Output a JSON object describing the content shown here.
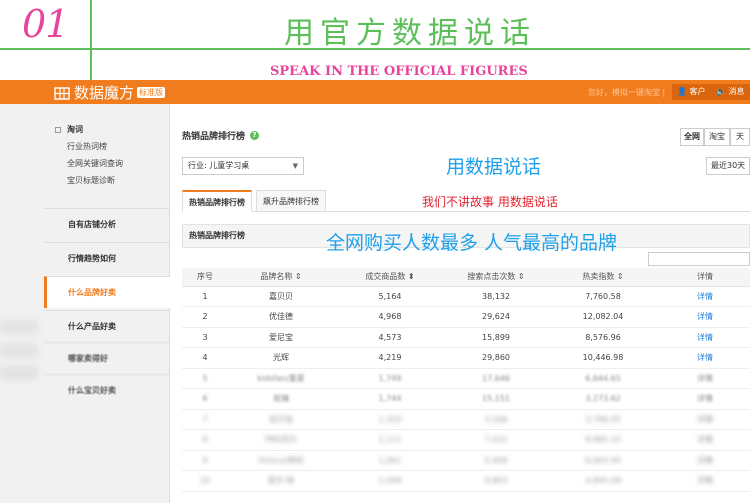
{
  "banner": {
    "number": "01",
    "headline": "用官方数据说话",
    "subtitle": "SPEAK IN THE OFFICIAL FIGURES",
    "accent_pink": "#e8449c",
    "accent_green": "#5cbf59"
  },
  "app": {
    "logo_text": "数据魔方",
    "edition": "标准版",
    "top_links": "您好，模拟一键淘宝 |",
    "client_button": "客户",
    "message_button": "消息",
    "brand_color": "#f07c1e"
  },
  "sidebar": {
    "group": {
      "title": "淘词",
      "items": [
        "行业热词榜",
        "全网关键词查询",
        "宝贝标题诊断"
      ]
    },
    "sections": [
      {
        "label": "自有店铺分析",
        "active": false
      },
      {
        "label": "行情趋势如何",
        "active": false
      },
      {
        "label": "什么品牌好卖",
        "active": true
      },
      {
        "label": "什么产品好卖",
        "active": false
      },
      {
        "label": "哪家卖得好",
        "active": false
      },
      {
        "label": "什么宝贝好卖",
        "active": false
      }
    ]
  },
  "main": {
    "title": "热销品牌排行榜",
    "help_icon": "?",
    "scope_tabs": [
      "全网",
      "淘宝",
      "天"
    ],
    "industry_select": "行业: 儿童学习桌",
    "date_range": "最近30天",
    "tabs": [
      "热销品牌排行榜",
      "飙升品牌排行榜"
    ],
    "panel_title": "热销品牌排行榜"
  },
  "overlays": {
    "top": "用数据说话",
    "middle": "我们不讲故事  用数据说话",
    "panel": "全网购买人数最多  人气最高的品牌",
    "blue": "#1fa0ea",
    "red": "#e0242f"
  },
  "table": {
    "headers": [
      "序号",
      "品牌名称 ⇕",
      "成交商品数 ⬍",
      "搜索点击次数 ⇕",
      "热卖指数 ⇕",
      "详情"
    ],
    "rows": [
      {
        "rank": "1",
        "brand": "嘉贝贝",
        "deals": "5,164",
        "clicks": "38,132",
        "index": "7,760.58",
        "detail": "详情"
      },
      {
        "rank": "2",
        "brand": "优佳德",
        "deals": "4,968",
        "clicks": "29,624",
        "index": "12,082.04",
        "detail": "详情"
      },
      {
        "rank": "3",
        "brand": "爱尼宝",
        "deals": "4,573",
        "clicks": "15,899",
        "index": "8,576.96",
        "detail": "详情"
      },
      {
        "rank": "4",
        "brand": "光辉",
        "deals": "4,219",
        "clicks": "29,860",
        "index": "10,446.98",
        "detail": "详情"
      },
      {
        "rank": "5",
        "brand": "kidsfan/童星",
        "deals": "1,749",
        "clicks": "17,646",
        "index": "6,644.65",
        "detail": "详情"
      },
      {
        "rank": "6",
        "brand": "斑斓",
        "deals": "1,744",
        "clicks": "15,151",
        "index": "3,273.62",
        "detail": "详情"
      },
      {
        "rank": "7",
        "brand": "佳贝佳",
        "deals": "1,320",
        "clicks": "3,166",
        "index": "3,796.45",
        "detail": "详情"
      },
      {
        "rank": "8",
        "brand": "PNE优贝",
        "deals": "1,111",
        "clicks": "7,022",
        "index": "8,965.15",
        "detail": "详情"
      },
      {
        "rank": "9",
        "brand": "Shinco/新科",
        "deals": "1,061",
        "clicks": "5,406",
        "index": "6,063.45",
        "detail": "详情"
      },
      {
        "rank": "10",
        "brand": "爱尔·林",
        "deals": "1,008",
        "clicks": "9,803",
        "index": "4,845.08",
        "detail": "详情"
      }
    ]
  }
}
